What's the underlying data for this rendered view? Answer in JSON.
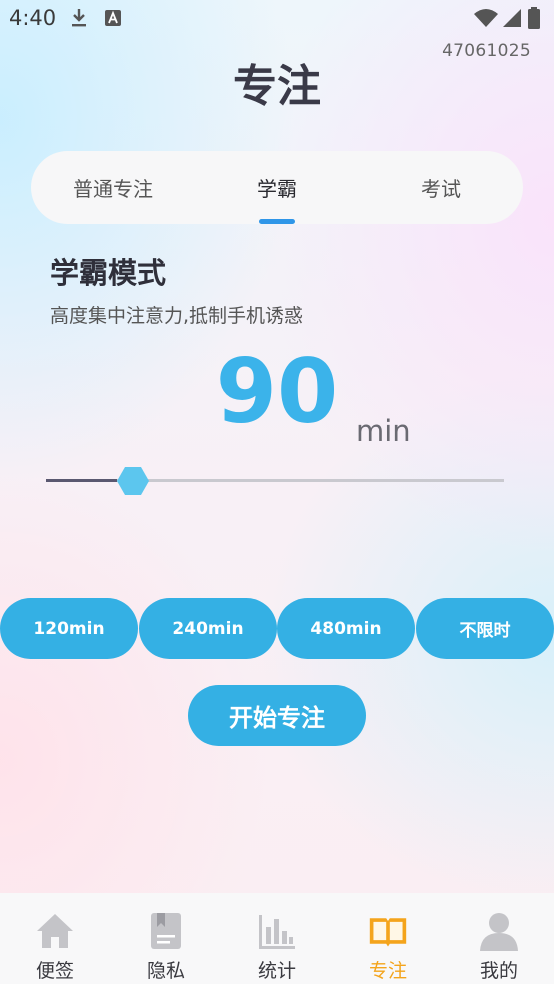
{
  "status_bar": {
    "time": "4:40"
  },
  "page_number": "47061025",
  "title": "专注",
  "tabs": [
    {
      "label": "普通专注",
      "active": false
    },
    {
      "label": "学霸",
      "active": true
    },
    {
      "label": "考试",
      "active": false
    }
  ],
  "mode": {
    "title": "学霸模式",
    "description": "高度集中注意力,抵制手机诱惑"
  },
  "timer": {
    "value": "90",
    "unit": "min",
    "slider_fraction": 0.19
  },
  "presets": [
    "120min",
    "240min",
    "480min",
    "不限时"
  ],
  "start_label": "开始专注",
  "bottom_nav": [
    {
      "label": "便签",
      "icon": "home-icon",
      "active": false
    },
    {
      "label": "隐私",
      "icon": "notebook-icon",
      "active": false
    },
    {
      "label": "统计",
      "icon": "bar-chart-icon",
      "active": false
    },
    {
      "label": "专注",
      "icon": "open-book-icon",
      "active": true
    },
    {
      "label": "我的",
      "icon": "user-icon",
      "active": false
    }
  ],
  "colors": {
    "accent": "#34b0e4",
    "big_number": "#3bb3ea",
    "tab_indicator": "#2f96e8",
    "nav_active": "#f4a41c",
    "nav_inactive_icon": "#c4c4c8"
  }
}
